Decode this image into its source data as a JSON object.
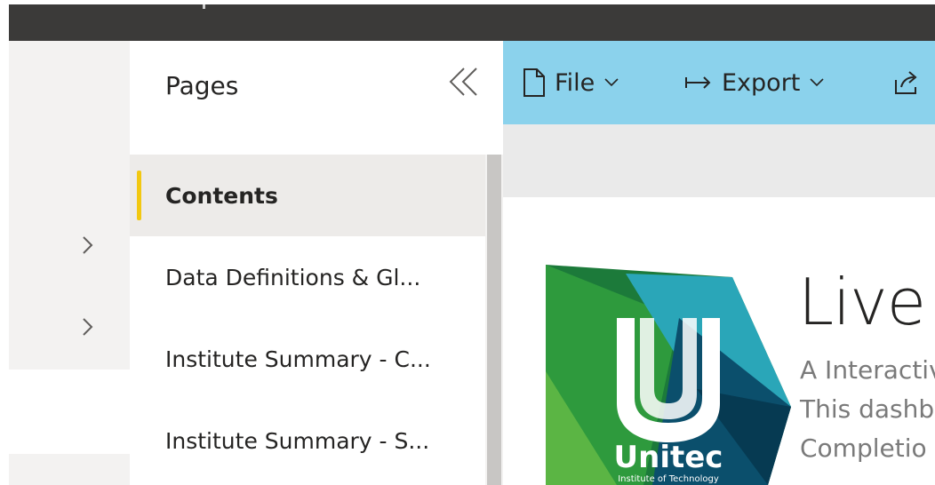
{
  "pages_pane": {
    "title": "Pages",
    "items": [
      {
        "label": "Contents",
        "active": true
      },
      {
        "label": "Data Definitions & Gl...",
        "active": false
      },
      {
        "label": "Institute Summary - C...",
        "active": false
      },
      {
        "label": "Institute Summary - S...",
        "active": false
      }
    ]
  },
  "toolbar": {
    "file_label": "File",
    "export_label": "Export"
  },
  "report": {
    "logo_text": "Unitec",
    "logo_subtext": "Institute of Technology",
    "title": "Live",
    "desc_lines": [
      "A Interactiv",
      "This dashb",
      "Completio"
    ]
  },
  "colors": {
    "toolbar_bg": "#8bd2ec",
    "active_indicator": "#f2c811",
    "top_bar": "#3b3a39"
  },
  "icons": [
    "chevron-right-icon",
    "double-chevron-left-icon",
    "file-icon",
    "chevron-down-icon",
    "export-arrow-icon",
    "share-icon"
  ]
}
